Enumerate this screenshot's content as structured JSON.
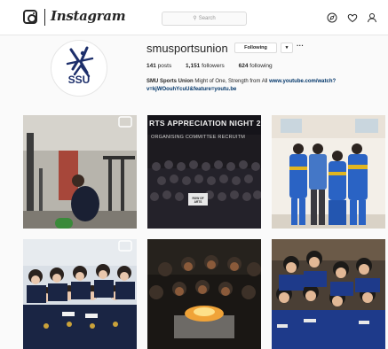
{
  "header": {
    "wordmark": "Instagram",
    "search_placeholder": "Search",
    "icons": [
      "instagram-logo-icon",
      "search-icon",
      "compass-icon",
      "heart-icon",
      "person-icon"
    ]
  },
  "profile": {
    "avatar_text": "SSU",
    "username": "smusportsunion",
    "follow_button": "Following",
    "stats": {
      "posts": "141",
      "posts_label": "posts",
      "followers": "1,151",
      "followers_label": "followers",
      "following": "624",
      "following_label": "following"
    },
    "bio_name": "SMU Sports Union",
    "bio_text": "Might of One, Strength from All",
    "bio_link": "www.youtube.com/watch?v=kjWOouhYcuU&feature=youtu.be"
  },
  "grid": {
    "post2_banner": "RTS APPRECIATION NIGHT 2",
    "post2_subbanner": "ORGANISING COMMITTEE RECRUITM",
    "post2_sign": "ROW OF ARTS"
  },
  "colors": {
    "accent": "#1d2f6b",
    "link": "#003569",
    "border": "#dbdbdb"
  }
}
